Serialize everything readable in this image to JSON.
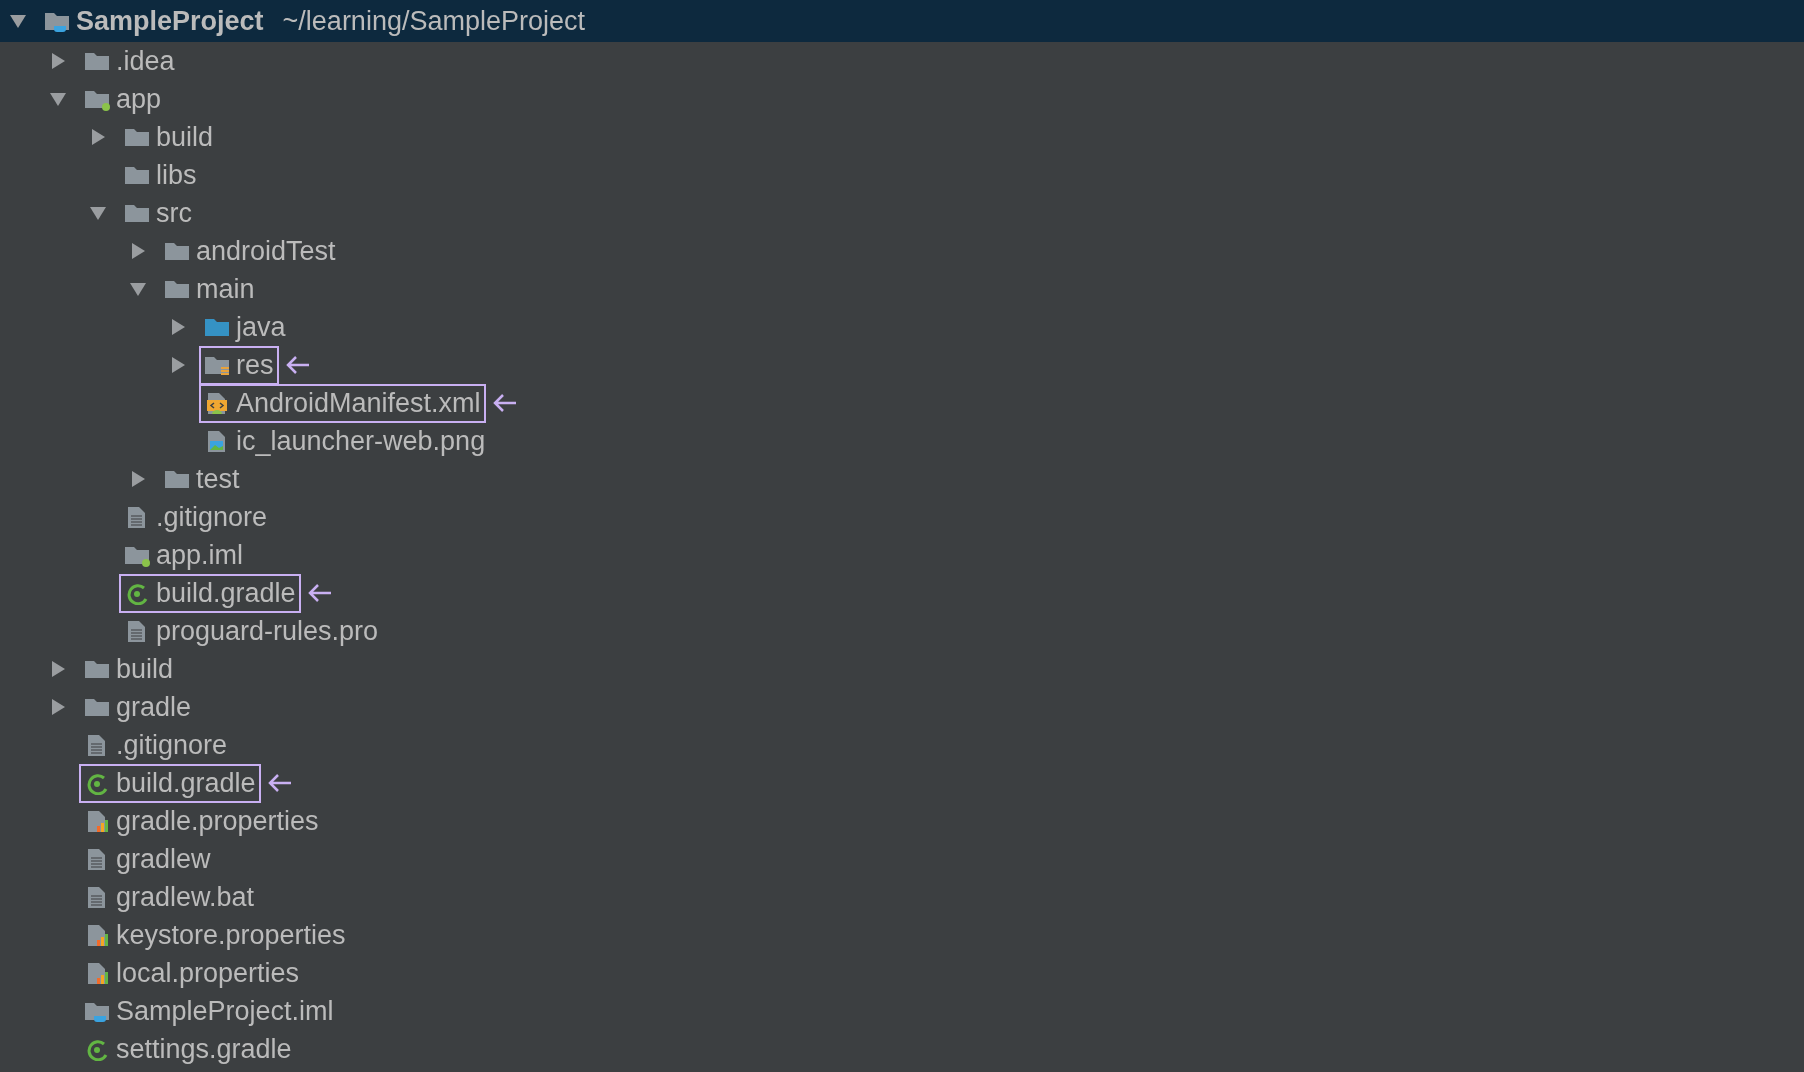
{
  "tree": {
    "name": "SampleProject",
    "path": "~/learning/SampleProject",
    "kind": "project",
    "selected": true,
    "expanded": true,
    "highlighted": false,
    "children": [
      {
        "name": ".idea",
        "kind": "folder",
        "selected": false,
        "expanded": false,
        "highlighted": false
      },
      {
        "name": "app",
        "kind": "module",
        "selected": false,
        "expanded": true,
        "highlighted": false,
        "children": [
          {
            "name": "build",
            "kind": "folder",
            "selected": false,
            "expanded": false,
            "highlighted": false
          },
          {
            "name": "libs",
            "kind": "folder",
            "selected": false,
            "highlighted": false
          },
          {
            "name": "src",
            "kind": "folder",
            "selected": false,
            "expanded": true,
            "highlighted": false,
            "children": [
              {
                "name": "androidTest",
                "kind": "folder",
                "selected": false,
                "expanded": false,
                "highlighted": false
              },
              {
                "name": "main",
                "kind": "folder",
                "selected": false,
                "expanded": true,
                "highlighted": false,
                "children": [
                  {
                    "name": "java",
                    "kind": "source",
                    "selected": false,
                    "expanded": false,
                    "highlighted": false
                  },
                  {
                    "name": "res",
                    "kind": "resource",
                    "selected": false,
                    "expanded": false,
                    "highlighted": true
                  },
                  {
                    "name": "AndroidManifest.xml",
                    "kind": "manifest",
                    "selected": false,
                    "highlighted": true
                  },
                  {
                    "name": "ic_launcher-web.png",
                    "kind": "image",
                    "selected": false,
                    "highlighted": false
                  }
                ]
              },
              {
                "name": "test",
                "kind": "folder",
                "selected": false,
                "expanded": false,
                "highlighted": false
              }
            ]
          },
          {
            "name": ".gitignore",
            "kind": "text",
            "selected": false,
            "highlighted": false
          },
          {
            "name": "app.iml",
            "kind": "module",
            "selected": false,
            "highlighted": false
          },
          {
            "name": "build.gradle",
            "kind": "gradle",
            "selected": false,
            "highlighted": true
          },
          {
            "name": "proguard-rules.pro",
            "kind": "text",
            "selected": false,
            "highlighted": false
          }
        ]
      },
      {
        "name": "build",
        "kind": "folder",
        "selected": false,
        "expanded": false,
        "highlighted": false
      },
      {
        "name": "gradle",
        "kind": "folder",
        "selected": false,
        "expanded": false,
        "highlighted": false
      },
      {
        "name": ".gitignore",
        "kind": "text",
        "selected": false,
        "highlighted": false
      },
      {
        "name": "build.gradle",
        "kind": "gradle",
        "selected": false,
        "highlighted": true
      },
      {
        "name": "gradle.properties",
        "kind": "properties",
        "selected": false,
        "highlighted": false
      },
      {
        "name": "gradlew",
        "kind": "text",
        "selected": false,
        "highlighted": false
      },
      {
        "name": "gradlew.bat",
        "kind": "text",
        "selected": false,
        "highlighted": false
      },
      {
        "name": "keystore.properties",
        "kind": "properties",
        "selected": false,
        "highlighted": false
      },
      {
        "name": "local.properties",
        "kind": "properties",
        "selected": false,
        "highlighted": false
      },
      {
        "name": "SampleProject.iml",
        "kind": "project",
        "selected": false,
        "highlighted": false
      },
      {
        "name": "settings.gradle",
        "kind": "gradle",
        "selected": false,
        "highlighted": false
      }
    ]
  }
}
